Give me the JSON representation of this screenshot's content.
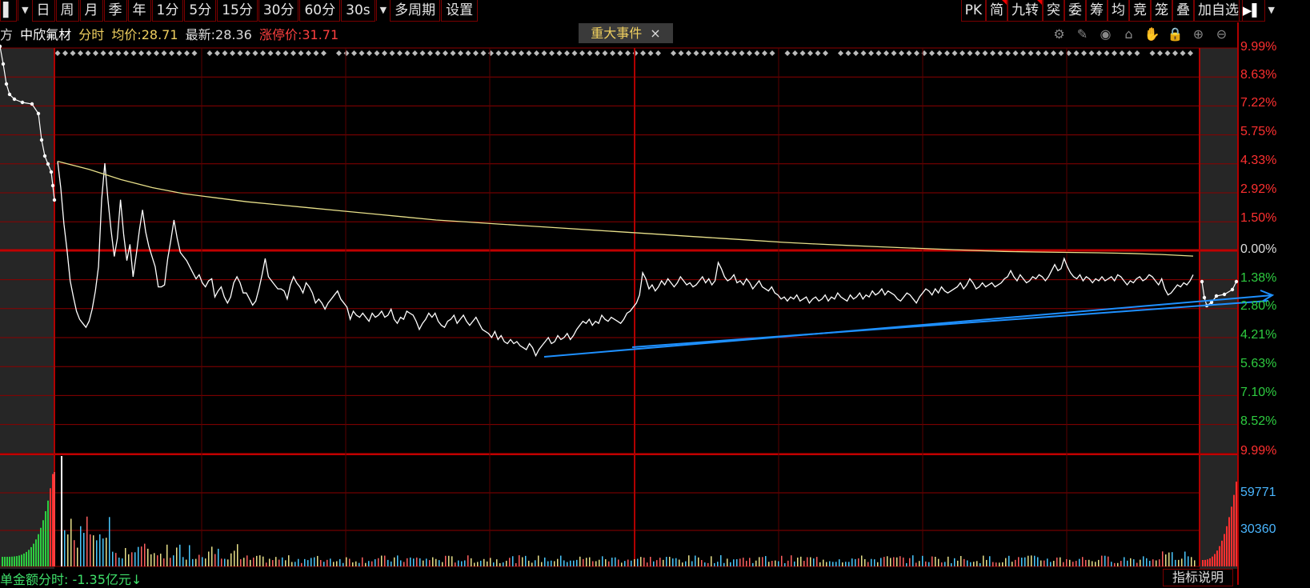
{
  "toolbar": {
    "left_items": [
      "日",
      "周",
      "月",
      "季",
      "年",
      "1分",
      "5分",
      "15分",
      "30分",
      "60分",
      "30s",
      "多周期",
      "设置"
    ],
    "right_items": [
      {
        "label": "PK",
        "flag": false
      },
      {
        "label": "简",
        "flag": true
      },
      {
        "label": "九转",
        "flag": true
      },
      {
        "label": "突",
        "flag": false
      },
      {
        "label": "委",
        "flag": false
      },
      {
        "label": "筹",
        "flag": false
      },
      {
        "label": "均",
        "flag": false
      },
      {
        "label": "竞",
        "flag": false
      },
      {
        "label": "笼",
        "flag": false
      },
      {
        "label": "叠",
        "flag": false
      },
      {
        "label": "加自选",
        "flag": false
      }
    ]
  },
  "info": {
    "prefix": "方",
    "stock_name": "中欣氟材",
    "mode": "分时",
    "avg_label": "均价:",
    "avg_value": "28.71",
    "last_label": "最新:",
    "last_value": "28.36",
    "limit_label": "涨停价:",
    "limit_value": "31.71"
  },
  "event_tag": {
    "label": "重大事件",
    "close": "×"
  },
  "tools": [
    "gear-icon",
    "pen-icon",
    "eye-icon",
    "bag-icon",
    "hand-icon",
    "lock-icon",
    "zoom-in-icon",
    "zoom-out-icon"
  ],
  "axis": {
    "up_labels": [
      "9.99%",
      "8.63%",
      "7.22%",
      "5.75%",
      "4.33%",
      "2.92%",
      "1.50%"
    ],
    "zero_label": "0.00%",
    "down_labels": [
      "1.38%",
      "2.80%",
      "4.21%",
      "5.63%",
      "7.10%",
      "8.52%",
      "9.99%"
    ],
    "volume_labels": [
      "59771",
      "30360"
    ]
  },
  "bottom": {
    "text": "单金额分时: -1.35亿元↓",
    "button": "指标说明"
  },
  "colors": {
    "grid": "#8b0000",
    "up": "#ff3030",
    "down": "#2ecc40",
    "avg_line": "#e8e08a",
    "price_line": "#ffffff",
    "trend_line": "#1e90ff",
    "volume_axis": "#4ab6ff"
  },
  "chart_data": {
    "type": "line",
    "title": "中欣氟材 分时",
    "series": [
      {
        "name": "最新",
        "unit": "pct_change",
        "values": [
          4.4,
          3.1,
          1.3,
          0.0,
          -1.5,
          -2.3,
          -3.0,
          -3.4,
          -3.6,
          -3.8,
          -3.5,
          -2.9,
          -2.0,
          -0.8,
          2.5,
          4.3,
          2.5,
          1.0,
          -0.3,
          0.6,
          2.5,
          0.8,
          -0.5,
          0.3,
          -1.3,
          -0.2,
          1.0,
          2.0,
          0.9,
          0.2,
          -0.3,
          -0.8,
          -1.8,
          -1.8,
          -1.7,
          -0.4,
          0.5,
          1.5,
          0.6,
          -0.1,
          -0.3,
          -0.5,
          -0.8,
          -1.1,
          -1.4,
          -1.2,
          -1.6,
          -1.8,
          -1.5,
          -1.4,
          -2.3,
          -2.0,
          -1.8,
          -2.3,
          -2.6,
          -2.3,
          -1.6,
          -1.3,
          -1.6,
          -2.1,
          -2.1,
          -2.4,
          -2.7,
          -2.5,
          -1.9,
          -1.2,
          -0.4,
          -1.3,
          -1.5,
          -1.7,
          -1.9,
          -1.9,
          -2.0,
          -2.4,
          -1.7,
          -1.3,
          -1.6,
          -1.8,
          -2.1,
          -1.6,
          -1.8,
          -2.1,
          -2.6,
          -2.4,
          -2.6,
          -2.9,
          -2.6,
          -2.4,
          -2.2,
          -2.0,
          -2.4,
          -2.6,
          -2.8,
          -3.4,
          -3.0,
          -3.2,
          -3.3,
          -3.1,
          -3.3,
          -3.5,
          -3.1,
          -3.3,
          -3.2,
          -3.0,
          -3.3,
          -3.2,
          -2.9,
          -3.4,
          -3.6,
          -3.3,
          -3.4,
          -3.0,
          -3.1,
          -3.2,
          -3.5,
          -3.9,
          -3.6,
          -3.4,
          -3.1,
          -3.3,
          -3.1,
          -3.5,
          -3.7,
          -3.8,
          -3.5,
          -3.4,
          -3.2,
          -3.6,
          -3.4,
          -3.2,
          -3.5,
          -3.7,
          -3.5,
          -3.3,
          -3.6,
          -3.9,
          -4.0,
          -4.1,
          -4.3,
          -4.0,
          -4.4,
          -4.2,
          -4.5,
          -4.6,
          -4.4,
          -4.6,
          -4.5,
          -4.7,
          -4.8,
          -4.9,
          -4.6,
          -4.8,
          -5.2,
          -4.9,
          -4.7,
          -4.5,
          -4.3,
          -4.6,
          -4.5,
          -4.2,
          -4.4,
          -4.3,
          -4.1,
          -4.4,
          -4.2,
          -3.9,
          -3.7,
          -3.5,
          -3.6,
          -3.4,
          -3.7,
          -3.5,
          -3.6,
          -3.2,
          -3.4,
          -3.5,
          -3.3,
          -3.4,
          -3.5,
          -3.6,
          -3.4,
          -3.1,
          -3.0,
          -2.8,
          -2.6,
          -2.2,
          -1.1,
          -1.4,
          -1.9,
          -1.7,
          -2.0,
          -1.8,
          -1.5,
          -1.7,
          -1.4,
          -1.6,
          -1.8,
          -1.6,
          -1.3,
          -1.5,
          -1.7,
          -1.6,
          -1.8,
          -1.7,
          -1.5,
          -1.3,
          -1.6,
          -1.4,
          -1.7,
          -1.5,
          -0.6,
          -0.9,
          -1.3,
          -1.5,
          -1.4,
          -1.2,
          -1.6,
          -1.5,
          -1.7,
          -1.4,
          -1.6,
          -1.9,
          -1.7,
          -1.5,
          -1.8,
          -1.9,
          -2.0,
          -1.8,
          -2.1,
          -2.2,
          -2.4,
          -2.3,
          -2.5,
          -2.3,
          -2.4,
          -2.2,
          -2.5,
          -2.4,
          -2.3,
          -2.6,
          -2.4,
          -2.3,
          -2.5,
          -2.4,
          -2.2,
          -2.5,
          -2.3,
          -2.4,
          -2.1,
          -2.3,
          -2.4,
          -2.5,
          -2.2,
          -2.4,
          -2.3,
          -2.1,
          -2.4,
          -2.2,
          -2.3,
          -2.0,
          -2.2,
          -2.1,
          -1.9,
          -2.2,
          -2.0,
          -2.1,
          -2.2,
          -2.4,
          -2.5,
          -2.3,
          -2.1,
          -2.2,
          -2.4,
          -2.6,
          -2.3,
          -2.1,
          -1.9,
          -2.0,
          -2.2,
          -1.9,
          -2.1,
          -1.8,
          -2.0,
          -2.1,
          -2.0,
          -1.9,
          -1.8,
          -1.6,
          -1.9,
          -1.7,
          -1.4,
          -1.6,
          -1.9,
          -1.8,
          -1.6,
          -1.8,
          -1.7,
          -1.6,
          -1.8,
          -1.7,
          -1.6,
          -1.4,
          -1.3,
          -1.0,
          -1.3,
          -1.5,
          -1.2,
          -1.4,
          -1.6,
          -1.5,
          -1.3,
          -1.4,
          -1.2,
          -1.3,
          -1.5,
          -1.3,
          -1.0,
          -0.7,
          -1.0,
          -0.9,
          -0.4,
          -0.8,
          -1.1,
          -1.3,
          -1.4,
          -1.2,
          -1.5,
          -1.3,
          -1.4,
          -1.6,
          -1.4,
          -1.5,
          -1.3,
          -1.5,
          -1.4,
          -1.3,
          -1.5,
          -1.2,
          -1.3,
          -1.5,
          -1.7,
          -1.5,
          -1.6,
          -1.4,
          -1.3,
          -1.5,
          -1.4,
          -1.2,
          -1.3,
          -1.5,
          -1.7,
          -1.4,
          -1.9,
          -2.2,
          -2.1,
          -1.9,
          -1.7,
          -1.8,
          -1.6,
          -1.7,
          -1.5,
          -1.2
        ]
      },
      {
        "name": "均价",
        "unit": "pct_change",
        "values": [
          4.4,
          4.0,
          3.5,
          3.1,
          2.8,
          2.6,
          2.4,
          2.25,
          2.1,
          1.95,
          1.8,
          1.65,
          1.5,
          1.4,
          1.3,
          1.2,
          1.1,
          1.0,
          0.9,
          0.8,
          0.7,
          0.6,
          0.5,
          0.4,
          0.32,
          0.25,
          0.18,
          0.12,
          0.06,
          0.0,
          -0.05,
          -0.08,
          -0.1,
          -0.12,
          -0.15,
          -0.2,
          -0.28
        ]
      }
    ],
    "ylim": [
      -9.99,
      9.99
    ],
    "ylabel": "",
    "volume": {
      "ylim": [
        0,
        89000
      ],
      "ticks": [
        59771,
        30360
      ]
    }
  }
}
